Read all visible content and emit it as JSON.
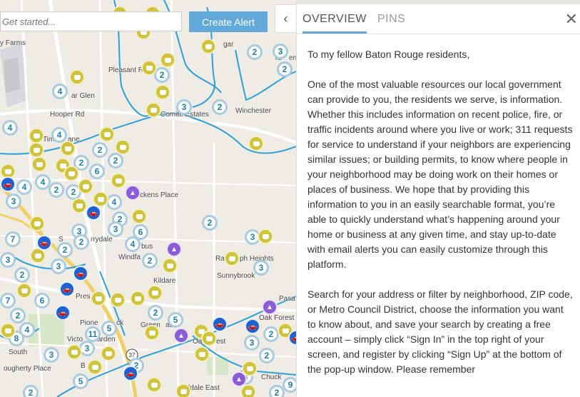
{
  "search": {
    "placeholder": "Get started...",
    "button": "Create Alert"
  },
  "panel": {
    "toggle_icon": "chevron-left-icon",
    "tabs": [
      "OVERVIEW",
      "PINS"
    ],
    "close_icon": "close-icon",
    "paragraphs": [
      "To my fellow Baton Rouge residents,",
      "One of the most valuable resources our local government can provide to you, the residents we serve, is information. Whether this includes information on recent police, fire, or traffic incidents around where you live or work; 311 requests for service to understand if your neighbors are experiencing similar issues; or building permits, to know where people in your neighborhood may be doing work on their homes or places of business. We hope that by providing this information to you in an easily searchable format, you’re able to quickly understand what’s happening around your home or business at any given time, and stay up-to-date with email alerts you can easily customize through this platform.",
      "Search for your address or filter by neighborhood, ZIP code, or Metro Council District, choose the information you want to know about, and save your search by creating a free account – simply click “Sign In” in the top right of your screen, and register by clicking “Sign Up” at the bottom of the pop-up window. Please remember"
    ]
  },
  "map": {
    "places": [
      "y Farms",
      "Pleasant R",
      "ar Glen",
      "Hooper Rd",
      "Comite Estates",
      "Winchester",
      "Tim",
      "ane",
      "ckens Place",
      "S",
      "rrydale",
      "Windfa",
      "bus",
      "Ra",
      "ph Heights",
      "Sunnybrook",
      "Kildare",
      "Pres",
      "Pione",
      "ck",
      "Green",
      "ace",
      "Victo",
      "arden",
      "South",
      "ougherty Place",
      "Oak Forest",
      "Oa",
      "est",
      "Ta",
      "en",
      "ldale East",
      "B",
      "Chuck",
      "Pasa",
      "gar"
    ],
    "route_shield": "37",
    "markers": {
      "num": [
        "4",
        "2",
        "3",
        "2",
        "4",
        "2",
        "2",
        "6",
        "4",
        "2",
        "4",
        "2",
        "2",
        "4",
        "3",
        "4",
        "2",
        "3",
        "3",
        "2",
        "6",
        "2",
        "3",
        "7",
        "4",
        "3",
        "2",
        "2",
        "2",
        "3",
        "3",
        "6",
        "7",
        "2",
        "4",
        "8",
        "11",
        "5",
        "3",
        "2",
        "5",
        "3",
        "2",
        "2",
        "9",
        "3",
        "5",
        "2",
        "2",
        "2",
        "3",
        "3",
        "2",
        "2"
      ],
      "car_icon": "car-icon",
      "speech_icon": "speech-bubble-icon",
      "park_icon": "park-icon"
    }
  },
  "colors": {
    "accent": "#62a8d8",
    "marker_blue": "#1d62d4",
    "marker_yellow": "#cfc33c",
    "marker_purple": "#8b5cd8",
    "boundary": "#2d9fd9"
  }
}
